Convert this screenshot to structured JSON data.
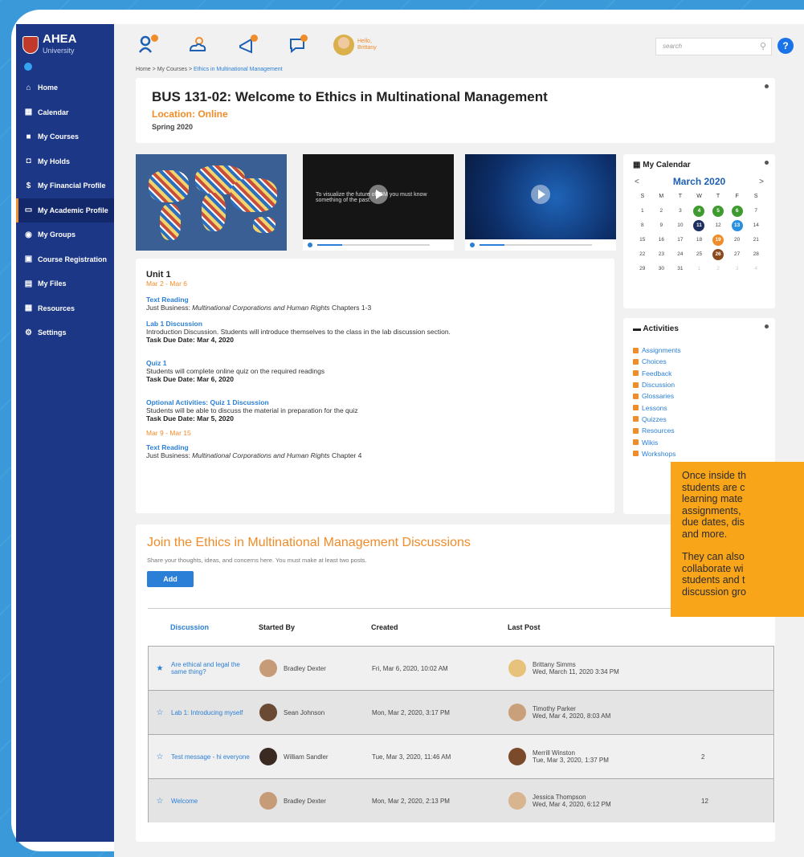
{
  "sidebar": {
    "logo_name": "AHEA",
    "logo_sub": "University",
    "items": [
      {
        "label": "Home"
      },
      {
        "label": "Calendar"
      },
      {
        "label": "My Courses"
      },
      {
        "label": "My Holds"
      },
      {
        "label": "My Financial Profile"
      },
      {
        "label": "My Academic Profile"
      },
      {
        "label": "My Groups"
      },
      {
        "label": "Course Registration"
      },
      {
        "label": "My Files"
      },
      {
        "label": "Resources"
      },
      {
        "label": "Settings"
      }
    ]
  },
  "topbar": {
    "greeting": "Hello,",
    "user": "Brittany",
    "search_placeholder": "search",
    "help": "?"
  },
  "breadcrumb": {
    "home": "Home",
    "sep": ">",
    "courses": "My Courses",
    "current": "Ethics in Multinational Management"
  },
  "course": {
    "title": "BUS 131-02: Welcome to Ethics in Multinational Management",
    "location": "Location: Online",
    "term": "Spring 2020"
  },
  "video_caption": "To visualize the future of IBM you must know something of the past.",
  "unit": {
    "title": "Unit 1",
    "week1": "Mar 2 - Mar 6",
    "text_reading": "Text Reading",
    "reading1_pre": "Just Business: ",
    "reading1_italic": "Multinational Corporations and Human Rights",
    "reading1_post": " Chapters 1-3",
    "lab_title": "Lab 1 Discussion",
    "lab_desc": "Introduction Discussion. Students will introduce themselves to the class in the lab discussion section.",
    "lab_due": "Task Due Date: Mar 4, 2020",
    "quiz_title": "Quiz 1",
    "quiz_desc": "Students will complete online quiz on the required readings",
    "quiz_due": "Task Due Date: Mar 6, 2020",
    "opt_title": "Optional Activities: Quiz 1 Discussion",
    "opt_desc": "Students will be able to discuss the material in preparation for the quiz",
    "opt_due": "Task Due Date: Mar 5, 2020",
    "week2": "Mar 9 - Mar 15",
    "reading2_pre": "Just Business: ",
    "reading2_italic": "Multinational Corporations and Human Rights",
    "reading2_post": " Chapter 4"
  },
  "calendar": {
    "title": "My Calendar",
    "month": "March 2020",
    "prev": "<",
    "next": ">",
    "dow": [
      "S",
      "M",
      "T",
      "W",
      "T",
      "F",
      "S"
    ],
    "days": [
      {
        "d": "1"
      },
      {
        "d": "2"
      },
      {
        "d": "3"
      },
      {
        "d": "4",
        "mark": "#3f9b2f"
      },
      {
        "d": "5",
        "mark": "#3f9b2f"
      },
      {
        "d": "6",
        "mark": "#3f9b2f"
      },
      {
        "d": "7"
      },
      {
        "d": "8"
      },
      {
        "d": "9"
      },
      {
        "d": "10"
      },
      {
        "d": "11",
        "mark": "#1d2f5e"
      },
      {
        "d": "12"
      },
      {
        "d": "13",
        "mark": "#2b8fe0"
      },
      {
        "d": "14"
      },
      {
        "d": "15"
      },
      {
        "d": "16"
      },
      {
        "d": "17"
      },
      {
        "d": "18"
      },
      {
        "d": "19",
        "mark": "#f08c29"
      },
      {
        "d": "20"
      },
      {
        "d": "21"
      },
      {
        "d": "22"
      },
      {
        "d": "23"
      },
      {
        "d": "24"
      },
      {
        "d": "25"
      },
      {
        "d": "26",
        "mark": "#8a4a1e"
      },
      {
        "d": "27"
      },
      {
        "d": "28"
      },
      {
        "d": "29"
      },
      {
        "d": "30"
      },
      {
        "d": "31"
      },
      {
        "d": "1",
        "muted": true
      },
      {
        "d": "2",
        "muted": true
      },
      {
        "d": "3",
        "muted": true
      },
      {
        "d": "4",
        "muted": true
      }
    ]
  },
  "activities": {
    "title": "Activities",
    "items": [
      {
        "label": "Assignments",
        "color": "#f08c29"
      },
      {
        "label": "Choices",
        "color": "#f08c29"
      },
      {
        "label": "Feedback",
        "color": "#f08c29"
      },
      {
        "label": "Discussion",
        "color": "#f08c29"
      },
      {
        "label": "Glossaries",
        "color": "#f08c29"
      },
      {
        "label": "Lessons",
        "color": "#f08c29"
      },
      {
        "label": "Quizzes",
        "color": "#f08c29"
      },
      {
        "label": "Resources",
        "color": "#f08c29"
      },
      {
        "label": "Wikis",
        "color": "#f08c29"
      },
      {
        "label": "Workshops",
        "color": "#f08c29"
      }
    ]
  },
  "discussions": {
    "title": "Join the Ethics in Multinational Management Discussions",
    "subtitle": "Share your thoughts, ideas, and concerns here. You must make at least two posts.",
    "add_label": "Add",
    "columns": [
      "Discussion",
      "Started By",
      "Created",
      "Last Post"
    ],
    "rows": [
      {
        "starred": true,
        "title": "Are ethical and legal the same thing?",
        "by": "Bradley Dexter",
        "created": "Fri, Mar 6, 2020, 10:02 AM",
        "last_name": "Brittany Simms",
        "last_date": "Wed, March 11, 2020 3:34 PM",
        "count": ""
      },
      {
        "starred": false,
        "title": "Lab 1: Introducing myself",
        "by": "Sean Johnson",
        "created": "Mon, Mar 2, 2020, 3:17 PM",
        "last_name": "Timothy Parker",
        "last_date": "Wed, Mar 4, 2020, 8:03 AM",
        "count": ""
      },
      {
        "starred": false,
        "title": "Test message - hi everyone",
        "by": "William Sandler",
        "created": "Tue, Mar 3, 2020, 11:46 AM",
        "last_name": "Merrill Winston",
        "last_date": "Tue, Mar 3, 2020, 1:37 PM",
        "count": "2"
      },
      {
        "starred": false,
        "title": "Welcome",
        "by": "Bradley Dexter",
        "created": "Mon, Mar 2, 2020, 2:13 PM",
        "last_name": "Jessica Thompson",
        "last_date": "Wed, Mar 4, 2020, 6:12 PM",
        "count": "12"
      }
    ]
  },
  "callout": {
    "p1": "Once inside th\nstudents are c\nlearning mate\nassignments,\ndue dates, dis\nand more.",
    "p2": "They can also\ncollaborate wi\nstudents and t\ndiscussion gro"
  },
  "colors": {
    "sidebar": "#1d3787",
    "accent": "#f08c29",
    "link": "#2b7fd6",
    "callout": "#f9a51a"
  }
}
